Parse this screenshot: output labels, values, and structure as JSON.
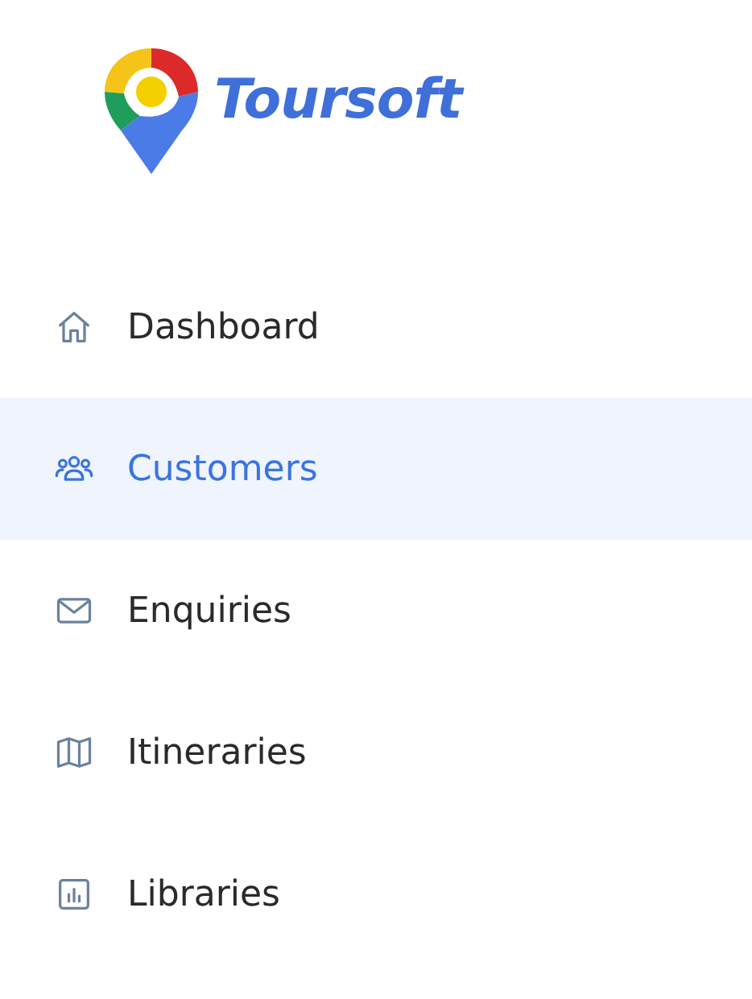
{
  "logo": {
    "text": "Toursoft"
  },
  "nav": [
    {
      "label": "Dashboard",
      "kind": "home",
      "selected": false
    },
    {
      "label": "Customers",
      "kind": "users",
      "selected": true
    },
    {
      "label": "Enquiries",
      "kind": "mail",
      "selected": false
    },
    {
      "label": "Itineraries",
      "kind": "map",
      "selected": false
    },
    {
      "label": "Libraries",
      "kind": "chart",
      "selected": false
    }
  ]
}
